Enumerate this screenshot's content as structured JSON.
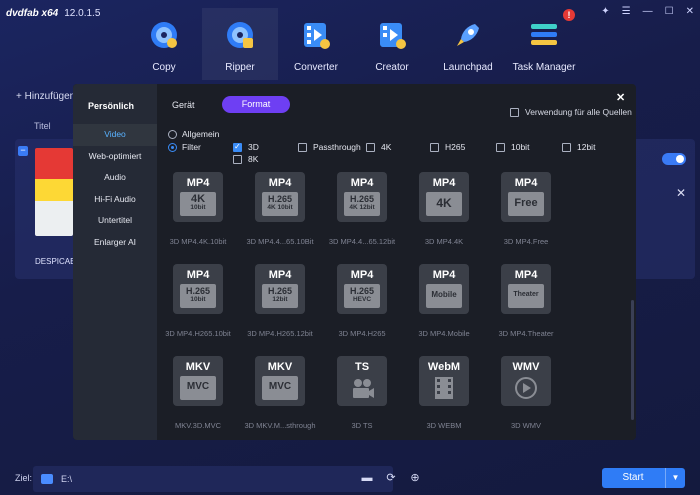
{
  "app": {
    "logo": "dvdfab x64",
    "version": "12.0.1.5",
    "notif_count": "!"
  },
  "nav": [
    {
      "label": "Copy",
      "icon": "copy-disc-icon",
      "color": "#2f7cf6"
    },
    {
      "label": "Ripper",
      "icon": "ripper-disc-icon",
      "color": "#2f7cf6"
    },
    {
      "label": "Converter",
      "icon": "converter-film-icon",
      "color": "#3a8cf6"
    },
    {
      "label": "Creator",
      "icon": "creator-film-icon",
      "color": "#3a8cf6"
    },
    {
      "label": "Launchpad",
      "icon": "rocket-icon",
      "color": "#5aa0ff"
    },
    {
      "label": "Task Manager",
      "icon": "task-list-icon",
      "color": "#3fd0c8"
    }
  ],
  "background": {
    "add_label": "Hinzufügen",
    "title_col": "Titel",
    "item_title": "DESPICAB"
  },
  "bottom": {
    "ziel_label": "Ziel:",
    "path": "E:\\",
    "start_label": "Start"
  },
  "modal": {
    "left_header": "Persönlich",
    "left_items": [
      "Video",
      "Web-optimiert",
      "Audio",
      "Hi-Fi Audio",
      "Untertitel",
      "Enlarger AI"
    ],
    "tabs": {
      "geraet": "Gerät",
      "format": "Format"
    },
    "all_sources_label": "Verwendung für alle Quellen",
    "radio_allgemein": "Allgemein",
    "radio_filter": "Filter",
    "filters": {
      "f3d": "3D",
      "f8k": "8K",
      "passthrough": "Passthrough",
      "f4k": "4K",
      "h265": "H265",
      "f10bit": "10bit",
      "f12bit": "12bit"
    },
    "tiles": [
      {
        "top": "MP4",
        "l1": "4K",
        "l2": "10bit",
        "label": "3D MP4.4K.10bit"
      },
      {
        "top": "MP4",
        "l1": "H.265",
        "l2": "4K 10bit",
        "label": "3D MP4.4...65.10Bit"
      },
      {
        "top": "MP4",
        "l1": "H.265",
        "l2": "4K 12bit",
        "label": "3D MP4.4...65.12bit"
      },
      {
        "top": "MP4",
        "l1": "4K",
        "l2": "",
        "label": "3D MP4.4K"
      },
      {
        "top": "MP4",
        "l1": "Free",
        "l2": "",
        "label": "3D MP4.Free"
      },
      {
        "top": "MP4",
        "l1": "H.265",
        "l2": "10bit",
        "label": "3D MP4.H265.10bit"
      },
      {
        "top": "MP4",
        "l1": "H.265",
        "l2": "12bit",
        "label": "3D MP4.H265.12bit"
      },
      {
        "top": "MP4",
        "l1": "H.265",
        "l2": "HEVC",
        "label": "3D MP4.H265"
      },
      {
        "top": "MP4",
        "l1": "Mobile",
        "l2": "",
        "label": "3D MP4.Mobile"
      },
      {
        "top": "MP4",
        "l1": "Theater",
        "l2": "",
        "label": "3D MP4.Theater"
      },
      {
        "top": "MKV",
        "l1": "MVC",
        "l2": "",
        "label": "MKV.3D.MVC"
      },
      {
        "top": "MKV",
        "l1": "MVC",
        "l2": "",
        "label": "3D MKV.M...sthrough"
      },
      {
        "top": "TS",
        "l1": "",
        "l2": "",
        "label": "3D TS",
        "icon": "camera-icon"
      },
      {
        "top": "WebM",
        "l1": "",
        "l2": "",
        "label": "3D WEBM",
        "icon": "film-icon"
      },
      {
        "top": "WMV",
        "l1": "",
        "l2": "",
        "label": "3D WMV",
        "icon": "play-icon"
      }
    ]
  }
}
